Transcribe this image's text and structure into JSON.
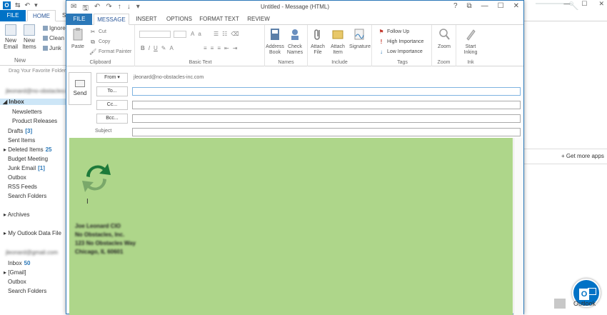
{
  "main": {
    "tabs": {
      "file": "FILE",
      "home": "HOME",
      "send": "SE"
    },
    "ribbon": {
      "new_email": "New Email",
      "new_items": "New Items",
      "ignore": "Ignore",
      "clean_up": "Clean",
      "junk": "Junk",
      "group_new": "New"
    },
    "favorites_hint": "Drag Your Favorite Folders Here",
    "account_1": "jleonard@no-obstacles-inc.com",
    "nav": {
      "inbox": "Inbox",
      "newsletters": "Newsletters",
      "product_releases": "Product Releases",
      "drafts": "Drafts",
      "drafts_count": "[3]",
      "sent_items": "Sent Items",
      "deleted_items": "Deleted Items",
      "deleted_count": "25",
      "budget_meeting": "Budget Meeting",
      "junk_email": "Junk Email",
      "junk_count": "[1]",
      "outbox": "Outbox",
      "rss_feeds": "RSS Feeds",
      "search_folders": "Search Folders",
      "archives": "Archives",
      "my_outlook_data_file": "My Outlook Data File",
      "account_2": "jleonard@gmail.com",
      "inbox_2": "Inbox",
      "inbox_2_count": "50",
      "gmail": "[Gmail]",
      "outbox_2": "Outbox",
      "search_folders_2": "Search Folders"
    },
    "get_more_apps": "Get more apps",
    "outlook_badge": "Outlook"
  },
  "compose": {
    "title": "Untitled - Message (HTML)",
    "window_controls": {
      "help": "?",
      "restore": "⧉",
      "minimize": "—",
      "maximize": "☐",
      "close": "✕"
    },
    "tabs": [
      "FILE",
      "MESSAGE",
      "INSERT",
      "OPTIONS",
      "FORMAT TEXT",
      "REVIEW"
    ],
    "ribbon": {
      "clipboard": {
        "paste": "Paste",
        "cut": "Cut",
        "copy": "Copy",
        "format_painter": "Format Painter",
        "label": "Clipboard"
      },
      "basic_text": {
        "label": "Basic Text",
        "bold": "B",
        "italic": "I",
        "underline": "U"
      },
      "names": {
        "address_book": "Address Book",
        "check_names": "Check Names",
        "label": "Names"
      },
      "include": {
        "attach_file": "Attach File",
        "attach_item": "Attach Item",
        "signature": "Signature",
        "label": "Include"
      },
      "tags": {
        "follow_up": "Follow Up",
        "high_importance": "High Importance",
        "low_importance": "Low Importance",
        "label": "Tags"
      },
      "zoom": {
        "zoom": "Zoom",
        "label": "Zoom"
      },
      "ink": {
        "start_inking": "Start Inking",
        "label": "Ink"
      }
    },
    "send": "Send",
    "from_label": "From",
    "from_value": "jleonard@no-obstacles-inc.com",
    "to_label": "To...",
    "cc_label": "Cc...",
    "bcc_label": "Bcc...",
    "subject_label": "Subject",
    "signature": [
      "Joe Leonard CIO",
      "No Obstacles, Inc.",
      "123 No Obstacles Way",
      "Chicago, IL 60601"
    ],
    "body_color": "#aed68a"
  }
}
